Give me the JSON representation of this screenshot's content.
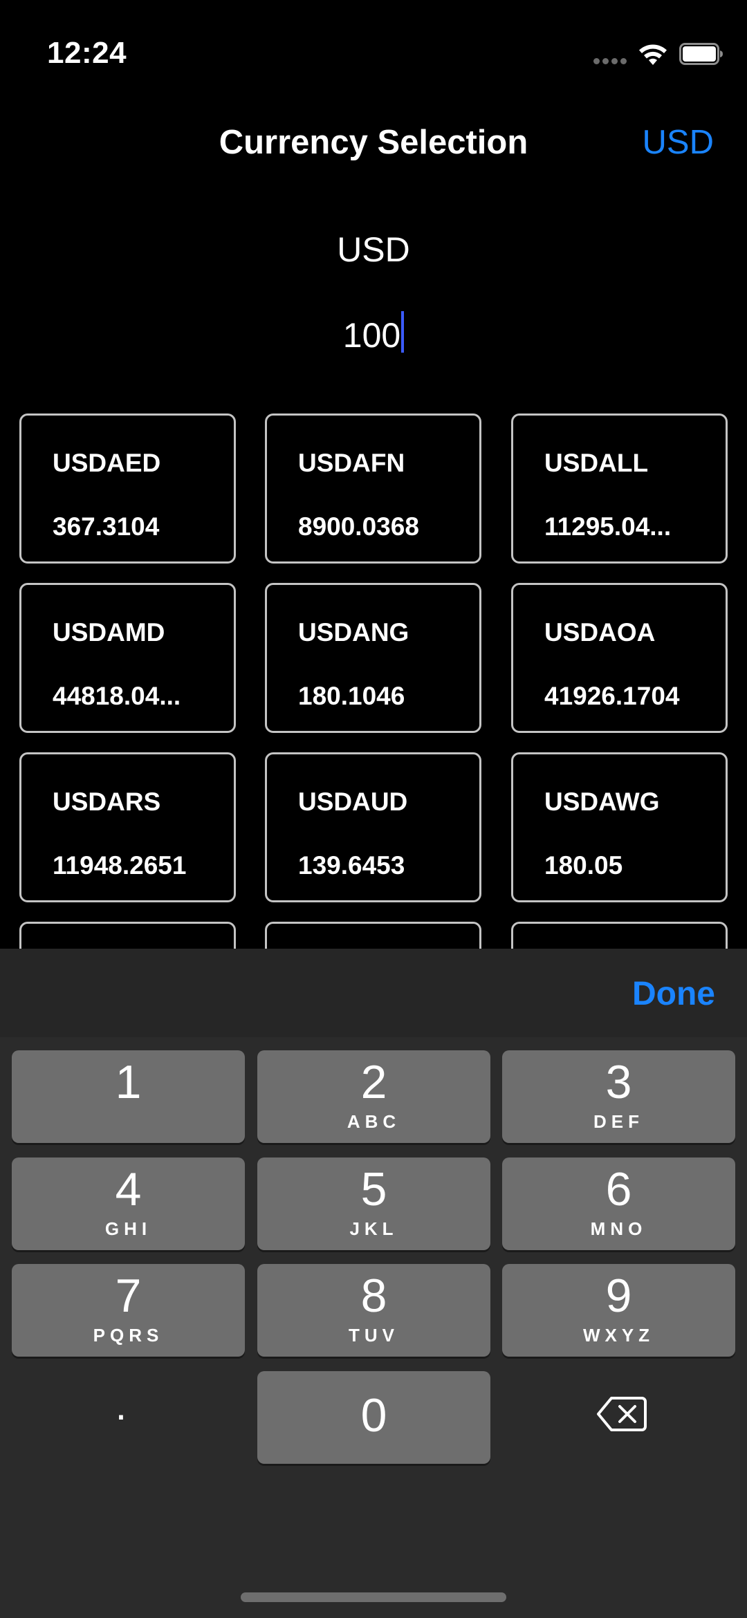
{
  "status_bar": {
    "time": "12:24"
  },
  "nav": {
    "title": "Currency Selection",
    "right_button": "USD"
  },
  "header": {
    "currency": "USD",
    "amount": "100"
  },
  "rates": [
    {
      "code": "USDAED",
      "value": "367.3104"
    },
    {
      "code": "USDAFN",
      "value": "8900.0368"
    },
    {
      "code": "USDALL",
      "value": "11295.04..."
    },
    {
      "code": "USDAMD",
      "value": "44818.04..."
    },
    {
      "code": "USDANG",
      "value": "180.1046"
    },
    {
      "code": "USDAOA",
      "value": "41926.1704"
    },
    {
      "code": "USDARS",
      "value": "11948.2651"
    },
    {
      "code": "USDAUD",
      "value": "139.6453"
    },
    {
      "code": "USDAWG",
      "value": "180.05"
    },
    {
      "code": "",
      "value": ""
    },
    {
      "code": "",
      "value": ""
    },
    {
      "code": "",
      "value": ""
    }
  ],
  "keyboard": {
    "done_label": "Done",
    "keys": [
      {
        "num": "1",
        "letters": ""
      },
      {
        "num": "2",
        "letters": "ABC"
      },
      {
        "num": "3",
        "letters": "DEF"
      },
      {
        "num": "4",
        "letters": "GHI"
      },
      {
        "num": "5",
        "letters": "JKL"
      },
      {
        "num": "6",
        "letters": "MNO"
      },
      {
        "num": "7",
        "letters": "PQRS"
      },
      {
        "num": "8",
        "letters": "TUV"
      },
      {
        "num": "9",
        "letters": "WXYZ"
      },
      {
        "num": "0",
        "letters": ""
      }
    ],
    "dot": "."
  },
  "colors": {
    "accent": "#1a84ff",
    "caret": "#3b5bff",
    "key": "#6e6e6e",
    "keyboard_bg": "#2b2b2b"
  }
}
